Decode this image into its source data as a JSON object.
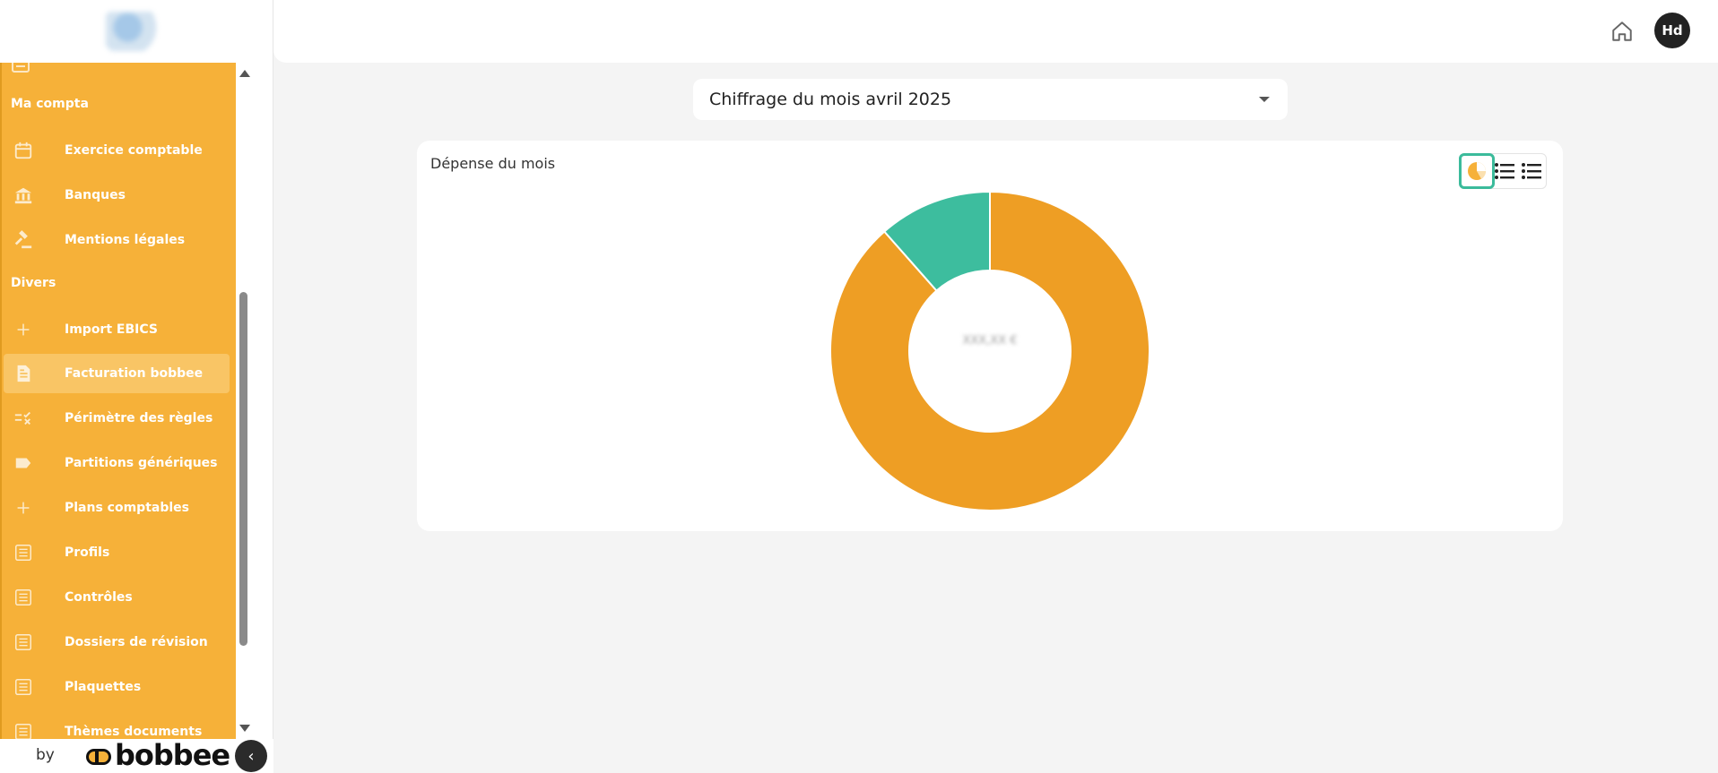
{
  "sidebar": {
    "sections": [
      {
        "title": "Ma compta"
      },
      {
        "title": "Divers"
      }
    ],
    "items": [
      {
        "label": "Exercice comptable",
        "icon": "calendar-icon"
      },
      {
        "label": "Banques",
        "icon": "bank-icon"
      },
      {
        "label": "Mentions légales",
        "icon": "gavel-icon"
      },
      {
        "label": "Import EBICS",
        "icon": "plus-icon"
      },
      {
        "label": "Facturation bobbee",
        "icon": "document-icon",
        "active": true
      },
      {
        "label": "Périmètre des règles",
        "icon": "rules-icon"
      },
      {
        "label": "Partitions génériques",
        "icon": "tag-icon"
      },
      {
        "label": "Plans comptables",
        "icon": "plus-icon"
      },
      {
        "label": "Profils",
        "icon": "list-icon"
      },
      {
        "label": "Contrôles",
        "icon": "list-icon"
      },
      {
        "label": "Dossiers de révision",
        "icon": "list-icon"
      },
      {
        "label": "Plaquettes",
        "icon": "list-icon"
      },
      {
        "label": "Thèmes documents",
        "icon": "list-icon"
      }
    ],
    "footer": {
      "by": "by",
      "brand": "bobbee"
    }
  },
  "header": {
    "avatar_initials": "Hd"
  },
  "month_select": {
    "value": "Chiffrage du mois avril 2025"
  },
  "card": {
    "title": "Dépense du mois",
    "center_value": "XXX,XX €"
  },
  "colors": {
    "accent": "#f6b139",
    "chart_orange": "#ee9e24",
    "chart_teal": "#3dbd9e"
  },
  "chart_data": {
    "type": "pie",
    "title": "Dépense du mois",
    "donut": true,
    "slices": [
      {
        "value": 88.5,
        "color": "#ee9e24"
      },
      {
        "value": 11.5,
        "color": "#3dbd9e"
      }
    ]
  }
}
